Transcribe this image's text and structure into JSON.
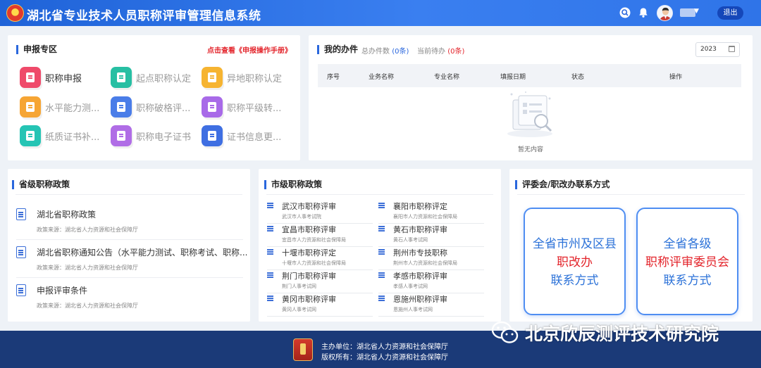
{
  "header": {
    "title": "湖北省专业技术人员职称评审管理信息系统",
    "logout_label": "退出",
    "icons": [
      "emblem-icon",
      "search-icon",
      "bell-icon",
      "avatar",
      "chevron-down-icon"
    ]
  },
  "apply": {
    "title": "申报专区",
    "manual_link": "点击查看《申报操作手册》",
    "items": [
      {
        "label": "职称申报",
        "icon": "form-icon",
        "color": "#ef4a6a",
        "active": true
      },
      {
        "label": "起点职称认定",
        "icon": "clipboard-check-icon",
        "color": "#27bfa3",
        "active": false
      },
      {
        "label": "异地职称认定",
        "icon": "building-icon",
        "color": "#f6b431",
        "active": false
      },
      {
        "label": "水平能力测...",
        "icon": "certificate-a-icon",
        "color": "#f6a534",
        "active": false
      },
      {
        "label": "职称破格评...",
        "icon": "briefcase-icon",
        "color": "#4a7de8",
        "active": false
      },
      {
        "label": "职称平级转...",
        "icon": "case-icon",
        "color": "#a86ae8",
        "active": false
      },
      {
        "label": "纸质证书补...",
        "icon": "document-list-icon",
        "color": "#25c4b4",
        "active": false
      },
      {
        "label": "职称电子证书",
        "icon": "badge-icon",
        "color": "#b06de6",
        "active": false
      },
      {
        "label": "证书信息更...",
        "icon": "refresh-icon",
        "color": "#3f6fe2",
        "active": false
      }
    ]
  },
  "todo": {
    "title": "我的办件",
    "total_label": "总办件数",
    "total_value": "(0条)",
    "pending_label": "当前待办",
    "pending_value": "(0条)",
    "year": "2023",
    "columns": [
      "序号",
      "业务名称",
      "专业名称",
      "填报日期",
      "状态",
      "操作"
    ],
    "empty_text": "暂无内容"
  },
  "province_policy": {
    "title": "省级职称政策",
    "items": [
      {
        "title": "湖北省职称政策",
        "source": "政策来源：湖北省人力资源和社会保障厅"
      },
      {
        "title": "湖北省职称通知公告（水平能力测试、职称考试、职称...",
        "source": "政策来源：湖北省人力资源和社会保障厅"
      },
      {
        "title": "申报评审条件",
        "source": "政策来源：湖北省人力资源和社会保障厅"
      }
    ]
  },
  "city_policy": {
    "title": "市级职称政策",
    "left": [
      {
        "title": "武汉市职称评审",
        "sub": "武汉市人事考试院"
      },
      {
        "title": "宜昌市职称评审",
        "sub": "宜昌市人力资源和社会保障局"
      },
      {
        "title": "十堰市职称评定",
        "sub": "十堰市人力资源和社会保障局"
      },
      {
        "title": "荆门市职称评审",
        "sub": "荆门人事考试网"
      },
      {
        "title": "黄冈市职称评审",
        "sub": "黄冈人事考试网"
      }
    ],
    "right": [
      {
        "title": "襄阳市职称评定",
        "sub": "襄阳市人力资源和社会保障局"
      },
      {
        "title": "黄石市职称评审",
        "sub": "黄石人事考试网"
      },
      {
        "title": "荆州市专技职称",
        "sub": "荆州市人力资源和社会保障局"
      },
      {
        "title": "孝感市职称评审",
        "sub": "孝感人事考试网"
      },
      {
        "title": "恩施州职称评审",
        "sub": "恩施州人事考试网"
      }
    ]
  },
  "contact": {
    "title": "评委会/职改办联系方式",
    "cards": [
      {
        "line1": "全省市州及区县",
        "line2": "职改办",
        "line3": "联系方式"
      },
      {
        "line1": "全省各级",
        "line2": "职称评审委员会",
        "line3": "联系方式"
      }
    ]
  },
  "footer": {
    "sponsor": "主办单位：湖北省人力资源和社会保障厅",
    "copyright": "版权所有：湖北省人力资源和社会保障厅",
    "watermark": "北京欣辰测评技术研究院"
  }
}
